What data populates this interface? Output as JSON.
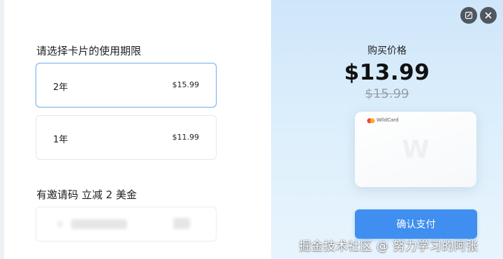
{
  "duration": {
    "title": "请选择卡片的使用期限",
    "options": [
      {
        "term": "2年",
        "price": "$15.99",
        "selected": true
      },
      {
        "term": "1年",
        "price": "$11.99",
        "selected": false
      }
    ]
  },
  "invite": {
    "title": "有邀请码 立减 2 美金"
  },
  "purchase": {
    "label": "购买价格",
    "price": "$13.99",
    "original_price": "$15.99",
    "card_brand": "WildCard",
    "card_mark": "W",
    "pay_button": "确认支付"
  },
  "icons": {
    "edit": "edit-icon",
    "close": "close-icon"
  },
  "watermark": "掘金技术社区 @ 努力学习的阿张",
  "colors": {
    "accent": "#3f8ef0",
    "selected_border": "#7fb3ea",
    "panel_bg": "#d9ecfb",
    "icon_bg": "#4f5761"
  }
}
